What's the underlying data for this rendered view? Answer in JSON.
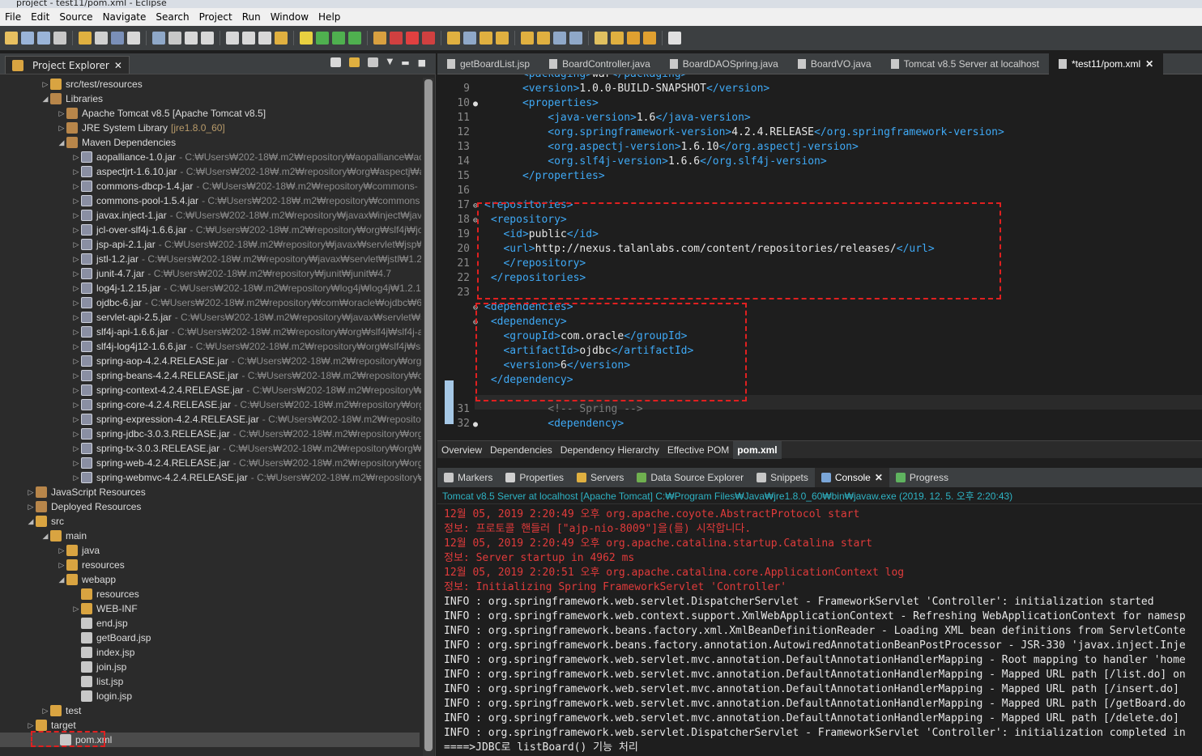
{
  "window": {
    "title": "project - test11/pom.xml - Eclipse"
  },
  "menu": [
    "File",
    "Edit",
    "Source",
    "Navigate",
    "Search",
    "Project",
    "Run",
    "Window",
    "Help"
  ],
  "project_explorer": {
    "tab_label": "Project Explorer",
    "rows": [
      {
        "label": "src/test/resources",
        "sub": "",
        "indent": 1,
        "arrow": "▷",
        "icon": "folder"
      },
      {
        "label": "Libraries",
        "sub": "",
        "indent": 1,
        "arrow": "◢",
        "icon": "lib"
      },
      {
        "label": "Apache Tomcat v8.5 [Apache Tomcat v8.5]",
        "sub": "",
        "indent": 2,
        "arrow": "▷",
        "icon": "lib"
      },
      {
        "label": "JRE System Library",
        "sub": "[jre1.8.0_60]",
        "indent": 2,
        "arrow": "▷",
        "icon": "lib",
        "ver": true
      },
      {
        "label": "Maven Dependencies",
        "sub": "",
        "indent": 2,
        "arrow": "◢",
        "icon": "lib"
      },
      {
        "label": "aopalliance-1.0.jar",
        "sub": "- C:₩Users₩202-18₩.m2₩repository₩aopalliance₩aop",
        "indent": 3,
        "arrow": "▷",
        "icon": "jar"
      },
      {
        "label": "aspectjrt-1.6.10.jar",
        "sub": "- C:₩Users₩202-18₩.m2₩repository₩org₩aspectj₩as",
        "indent": 3,
        "arrow": "▷",
        "icon": "jar"
      },
      {
        "label": "commons-dbcp-1.4.jar",
        "sub": "- C:₩Users₩202-18₩.m2₩repository₩commons-",
        "indent": 3,
        "arrow": "▷",
        "icon": "jar"
      },
      {
        "label": "commons-pool-1.5.4.jar",
        "sub": "- C:₩Users₩202-18₩.m2₩repository₩commons",
        "indent": 3,
        "arrow": "▷",
        "icon": "jar"
      },
      {
        "label": "javax.inject-1.jar",
        "sub": "- C:₩Users₩202-18₩.m2₩repository₩javax₩inject₩java",
        "indent": 3,
        "arrow": "▷",
        "icon": "jar"
      },
      {
        "label": "jcl-over-slf4j-1.6.6.jar",
        "sub": "- C:₩Users₩202-18₩.m2₩repository₩org₩slf4j₩jc",
        "indent": 3,
        "arrow": "▷",
        "icon": "jar"
      },
      {
        "label": "jsp-api-2.1.jar",
        "sub": "- C:₩Users₩202-18₩.m2₩repository₩javax₩servlet₩jsp₩j",
        "indent": 3,
        "arrow": "▷",
        "icon": "jar"
      },
      {
        "label": "jstl-1.2.jar",
        "sub": "- C:₩Users₩202-18₩.m2₩repository₩javax₩servlet₩jstl₩1.2",
        "indent": 3,
        "arrow": "▷",
        "icon": "jar"
      },
      {
        "label": "junit-4.7.jar",
        "sub": "- C:₩Users₩202-18₩.m2₩repository₩junit₩junit₩4.7",
        "indent": 3,
        "arrow": "▷",
        "icon": "jar"
      },
      {
        "label": "log4j-1.2.15.jar",
        "sub": "- C:₩Users₩202-18₩.m2₩repository₩log4j₩log4j₩1.2.1",
        "indent": 3,
        "arrow": "▷",
        "icon": "jar"
      },
      {
        "label": "ojdbc-6.jar",
        "sub": "- C:₩Users₩202-18₩.m2₩repository₩com₩oracle₩ojdbc₩6",
        "indent": 3,
        "arrow": "▷",
        "icon": "jar"
      },
      {
        "label": "servlet-api-2.5.jar",
        "sub": "- C:₩Users₩202-18₩.m2₩repository₩javax₩servlet₩se",
        "indent": 3,
        "arrow": "▷",
        "icon": "jar"
      },
      {
        "label": "slf4j-api-1.6.6.jar",
        "sub": "- C:₩Users₩202-18₩.m2₩repository₩org₩slf4j₩slf4j-a",
        "indent": 3,
        "arrow": "▷",
        "icon": "jar"
      },
      {
        "label": "slf4j-log4j12-1.6.6.jar",
        "sub": "- C:₩Users₩202-18₩.m2₩repository₩org₩slf4j₩sl",
        "indent": 3,
        "arrow": "▷",
        "icon": "jar"
      },
      {
        "label": "spring-aop-4.2.4.RELEASE.jar",
        "sub": "- C:₩Users₩202-18₩.m2₩repository₩org₩",
        "indent": 3,
        "arrow": "▷",
        "icon": "jar"
      },
      {
        "label": "spring-beans-4.2.4.RELEASE.jar",
        "sub": "- C:₩Users₩202-18₩.m2₩repository₩org",
        "indent": 3,
        "arrow": "▷",
        "icon": "jar"
      },
      {
        "label": "spring-context-4.2.4.RELEASE.jar",
        "sub": "- C:₩Users₩202-18₩.m2₩repository₩o",
        "indent": 3,
        "arrow": "▷",
        "icon": "jar"
      },
      {
        "label": "spring-core-4.2.4.RELEASE.jar",
        "sub": "- C:₩Users₩202-18₩.m2₩repository₩org",
        "indent": 3,
        "arrow": "▷",
        "icon": "jar"
      },
      {
        "label": "spring-expression-4.2.4.RELEASE.jar",
        "sub": "- C:₩Users₩202-18₩.m2₩repository",
        "indent": 3,
        "arrow": "▷",
        "icon": "jar"
      },
      {
        "label": "spring-jdbc-3.0.3.RELEASE.jar",
        "sub": "- C:₩Users₩202-18₩.m2₩repository₩org",
        "indent": 3,
        "arrow": "▷",
        "icon": "jar"
      },
      {
        "label": "spring-tx-3.0.3.RELEASE.jar",
        "sub": "- C:₩Users₩202-18₩.m2₩repository₩org₩sp",
        "indent": 3,
        "arrow": "▷",
        "icon": "jar"
      },
      {
        "label": "spring-web-4.2.4.RELEASE.jar",
        "sub": "- C:₩Users₩202-18₩.m2₩repository₩org₩",
        "indent": 3,
        "arrow": "▷",
        "icon": "jar"
      },
      {
        "label": "spring-webmvc-4.2.4.RELEASE.jar",
        "sub": "- C:₩Users₩202-18₩.m2₩repository₩o",
        "indent": 3,
        "arrow": "▷",
        "icon": "jar"
      },
      {
        "label": "JavaScript Resources",
        "sub": "",
        "indent": 0,
        "arrow": "▷",
        "icon": "lib"
      },
      {
        "label": "Deployed Resources",
        "sub": "",
        "indent": 0,
        "arrow": "▷",
        "icon": "lib"
      },
      {
        "label": "src",
        "sub": "",
        "indent": 0,
        "arrow": "◢",
        "icon": "folder"
      },
      {
        "label": "main",
        "sub": "",
        "indent": 1,
        "arrow": "◢",
        "icon": "folder"
      },
      {
        "label": "java",
        "sub": "",
        "indent": 2,
        "arrow": "▷",
        "icon": "folder"
      },
      {
        "label": "resources",
        "sub": "",
        "indent": 2,
        "arrow": "▷",
        "icon": "folder"
      },
      {
        "label": "webapp",
        "sub": "",
        "indent": 2,
        "arrow": "◢",
        "icon": "folder"
      },
      {
        "label": "resources",
        "sub": "",
        "indent": 3,
        "arrow": "",
        "icon": "folder"
      },
      {
        "label": "WEB-INF",
        "sub": "",
        "indent": 3,
        "arrow": "▷",
        "icon": "folder"
      },
      {
        "label": "end.jsp",
        "sub": "",
        "indent": 3,
        "arrow": "",
        "icon": "file"
      },
      {
        "label": "getBoard.jsp",
        "sub": "",
        "indent": 3,
        "arrow": "",
        "icon": "file"
      },
      {
        "label": "index.jsp",
        "sub": "",
        "indent": 3,
        "arrow": "",
        "icon": "file"
      },
      {
        "label": "join.jsp",
        "sub": "",
        "indent": 3,
        "arrow": "",
        "icon": "file"
      },
      {
        "label": "list.jsp",
        "sub": "",
        "indent": 3,
        "arrow": "",
        "icon": "file"
      },
      {
        "label": "login.jsp",
        "sub": "",
        "indent": 3,
        "arrow": "",
        "icon": "file"
      },
      {
        "label": "test",
        "sub": "",
        "indent": 1,
        "arrow": "▷",
        "icon": "folder"
      },
      {
        "label": "target",
        "sub": "",
        "indent": 0,
        "arrow": "▷",
        "icon": "folder"
      },
      {
        "label": "pom.xml",
        "sub": "",
        "indent": 1,
        "arrow": "",
        "icon": "file",
        "selected": true
      }
    ]
  },
  "editor_tabs": [
    {
      "label": "getBoardList.jsp",
      "active": false
    },
    {
      "label": "BoardController.java",
      "active": false
    },
    {
      "label": "BoardDAOSpring.java",
      "active": false
    },
    {
      "label": "BoardVO.java",
      "active": false
    },
    {
      "label": "Tomcat v8.5 Server at localhost",
      "active": false
    },
    {
      "label": "*test11/pom.xml",
      "active": true
    }
  ],
  "code_lines": [
    {
      "n": "",
      "m": "",
      "indent": 6,
      "parts": [
        [
          "tag",
          "<packaging>"
        ],
        [
          "txt",
          "war"
        ],
        [
          "tag",
          "</packaging>"
        ]
      ]
    },
    {
      "n": "9",
      "m": "",
      "indent": 6,
      "parts": [
        [
          "tag",
          "<version>"
        ],
        [
          "txt",
          "1.0.0-BUILD-SNAPSHOT"
        ],
        [
          "tag",
          "</version>"
        ]
      ]
    },
    {
      "n": "10",
      "m": "●",
      "indent": 6,
      "parts": [
        [
          "tag",
          "<properties>"
        ]
      ]
    },
    {
      "n": "11",
      "m": "",
      "indent": 10,
      "parts": [
        [
          "tag",
          "<java-version>"
        ],
        [
          "txt",
          "1.6"
        ],
        [
          "tag",
          "</java-version>"
        ]
      ]
    },
    {
      "n": "12",
      "m": "",
      "indent": 10,
      "parts": [
        [
          "tag",
          "<org.springframework-version>"
        ],
        [
          "txt",
          "4.2.4.RELEASE"
        ],
        [
          "tag",
          "</org.springframework-version>"
        ]
      ]
    },
    {
      "n": "13",
      "m": "",
      "indent": 10,
      "parts": [
        [
          "tag",
          "<org.aspectj-version>"
        ],
        [
          "txt",
          "1.6.10"
        ],
        [
          "tag",
          "</org.aspectj-version>"
        ]
      ]
    },
    {
      "n": "14",
      "m": "",
      "indent": 10,
      "parts": [
        [
          "tag",
          "<org.slf4j-version>"
        ],
        [
          "txt",
          "1.6.6"
        ],
        [
          "tag",
          "</org.slf4j-version>"
        ]
      ]
    },
    {
      "n": "15",
      "m": "",
      "indent": 6,
      "parts": [
        [
          "tag",
          "</properties>"
        ]
      ]
    },
    {
      "n": "16",
      "m": "",
      "indent": 0,
      "parts": []
    },
    {
      "n": "17",
      "m": "⊖",
      "indent": 0,
      "parts": [
        [
          "tag",
          "<repositories>"
        ]
      ]
    },
    {
      "n": "18",
      "m": "⊖",
      "indent": 1,
      "parts": [
        [
          "tag",
          "<repository>"
        ]
      ]
    },
    {
      "n": "19",
      "m": "",
      "indent": 3,
      "parts": [
        [
          "tag",
          "<id>"
        ],
        [
          "txt",
          "public"
        ],
        [
          "tag",
          "</id>"
        ]
      ]
    },
    {
      "n": "20",
      "m": "",
      "indent": 3,
      "parts": [
        [
          "tag",
          "<url>"
        ],
        [
          "txt",
          "http://nexus.talanlabs.com/content/repositories/releases/"
        ],
        [
          "tag",
          "</url>"
        ]
      ]
    },
    {
      "n": "21",
      "m": "",
      "indent": 3,
      "parts": [
        [
          "tag",
          "</repository>"
        ]
      ]
    },
    {
      "n": "22",
      "m": "",
      "indent": 1,
      "parts": [
        [
          "tag",
          "</repositories>"
        ]
      ]
    },
    {
      "n": "23",
      "m": "",
      "indent": 0,
      "parts": []
    },
    {
      "n": "",
      "m": "⊖",
      "indent": 0,
      "parts": [
        [
          "tag",
          "<dependencies>"
        ]
      ]
    },
    {
      "n": "",
      "m": "⊖",
      "indent": 1,
      "parts": [
        [
          "tag",
          "<dependency>"
        ]
      ]
    },
    {
      "n": "",
      "m": "",
      "indent": 3,
      "parts": [
        [
          "tag",
          "<groupId>"
        ],
        [
          "txt",
          "com.oracle"
        ],
        [
          "tag",
          "</groupId>"
        ]
      ]
    },
    {
      "n": "",
      "m": "",
      "indent": 3,
      "parts": [
        [
          "tag",
          "<artifactId>"
        ],
        [
          "txt",
          "ojdbc"
        ],
        [
          "tag",
          "</artifactId>"
        ]
      ]
    },
    {
      "n": "",
      "m": "",
      "indent": 3,
      "parts": [
        [
          "tag",
          "<version>"
        ],
        [
          "txt",
          "6"
        ],
        [
          "tag",
          "</version>"
        ]
      ]
    },
    {
      "n": "",
      "m": "",
      "indent": 1,
      "parts": [
        [
          "tag",
          "</dependency>"
        ]
      ]
    },
    {
      "n": "",
      "m": "",
      "indent": 0,
      "parts": []
    },
    {
      "n": "31",
      "m": "",
      "indent": 10,
      "parts": [
        [
          "cmt",
          "<!-- Spring -->"
        ]
      ]
    },
    {
      "n": "32",
      "m": "●",
      "indent": 10,
      "parts": [
        [
          "tag",
          "<dependency>"
        ]
      ]
    }
  ],
  "pom_tabs": [
    {
      "label": "Overview",
      "active": false
    },
    {
      "label": "Dependencies",
      "active": false
    },
    {
      "label": "Dependency Hierarchy",
      "active": false
    },
    {
      "label": "Effective POM",
      "active": false
    },
    {
      "label": "pom.xml",
      "active": true
    }
  ],
  "console_tabs": [
    {
      "label": "Markers",
      "color": "#c8c8c8",
      "active": false
    },
    {
      "label": "Properties",
      "color": "#d0d0d0",
      "active": false
    },
    {
      "label": "Servers",
      "color": "#e0b040",
      "active": false
    },
    {
      "label": "Data Source Explorer",
      "color": "#6fb04f",
      "active": false
    },
    {
      "label": "Snippets",
      "color": "#c8c8c8",
      "active": false
    },
    {
      "label": "Console",
      "color": "#7aa6d8",
      "active": true
    },
    {
      "label": "Progress",
      "color": "#5fb35f",
      "active": false
    }
  ],
  "console_header": "Tomcat v8.5 Server at localhost [Apache Tomcat] C:₩Program Files₩Java₩jre1.8.0_60₩bin₩javaw.exe (2019. 12. 5. 오후 2:20:43)",
  "console_lines": [
    {
      "c": "red",
      "t": "12월 05, 2019 2:20:49 오후 org.apache.coyote.AbstractProtocol start"
    },
    {
      "c": "red",
      "t": "정보: 프로토콜 핸들러 [\"ajp-nio-8009\"]을(를) 시작합니다."
    },
    {
      "c": "red",
      "t": "12월 05, 2019 2:20:49 오후 org.apache.catalina.startup.Catalina start"
    },
    {
      "c": "red",
      "t": "정보: Server startup in 4962 ms"
    },
    {
      "c": "red",
      "t": "12월 05, 2019 2:20:51 오후 org.apache.catalina.core.ApplicationContext log"
    },
    {
      "c": "red",
      "t": "정보: Initializing Spring FrameworkServlet 'Controller'"
    },
    {
      "c": "wht",
      "t": "INFO : org.springframework.web.servlet.DispatcherServlet - FrameworkServlet 'Controller': initialization started"
    },
    {
      "c": "wht",
      "t": "INFO : org.springframework.web.context.support.XmlWebApplicationContext - Refreshing WebApplicationContext for namesp"
    },
    {
      "c": "wht",
      "t": "INFO : org.springframework.beans.factory.xml.XmlBeanDefinitionReader - Loading XML bean definitions from ServletConte"
    },
    {
      "c": "wht",
      "t": "INFO : org.springframework.beans.factory.annotation.AutowiredAnnotationBeanPostProcessor - JSR-330 'javax.inject.Inje"
    },
    {
      "c": "wht",
      "t": "INFO : org.springframework.web.servlet.mvc.annotation.DefaultAnnotationHandlerMapping - Root mapping to handler 'home"
    },
    {
      "c": "wht",
      "t": "INFO : org.springframework.web.servlet.mvc.annotation.DefaultAnnotationHandlerMapping - Mapped URL path [/list.do] on"
    },
    {
      "c": "wht",
      "t": "INFO : org.springframework.web.servlet.mvc.annotation.DefaultAnnotationHandlerMapping - Mapped URL path [/insert.do]"
    },
    {
      "c": "wht",
      "t": "INFO : org.springframework.web.servlet.mvc.annotation.DefaultAnnotationHandlerMapping - Mapped URL path [/getBoard.do"
    },
    {
      "c": "wht",
      "t": "INFO : org.springframework.web.servlet.mvc.annotation.DefaultAnnotationHandlerMapping - Mapped URL path [/delete.do]"
    },
    {
      "c": "wht",
      "t": "INFO : org.springframework.web.servlet.DispatcherServlet - FrameworkServlet 'Controller': initialization completed in"
    },
    {
      "c": "wht",
      "t": "====>JDBC로 listBoard() 기능 처리"
    }
  ]
}
